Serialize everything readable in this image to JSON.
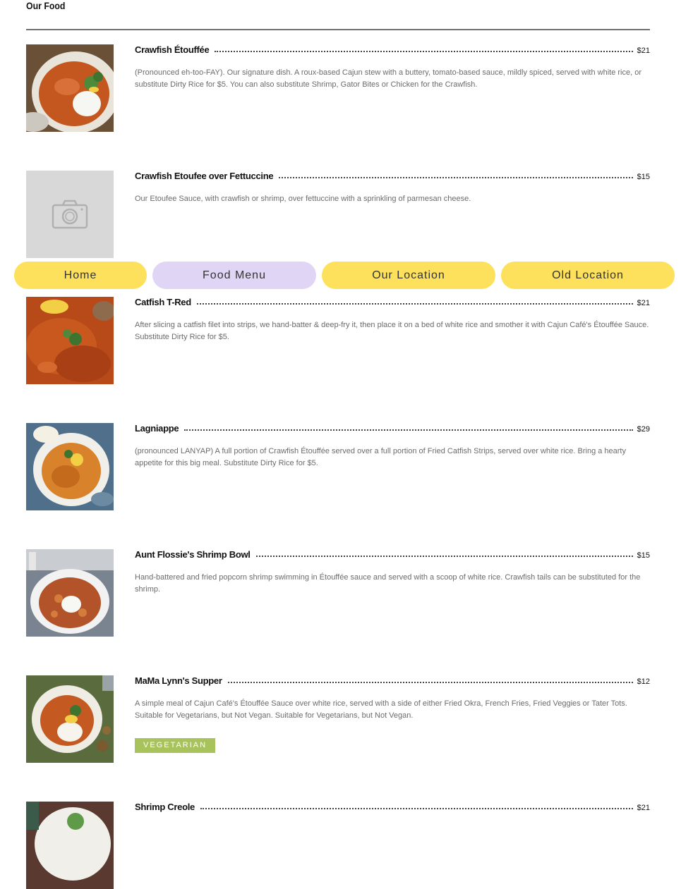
{
  "section": {
    "title": "Our Food"
  },
  "nav": {
    "items": [
      {
        "label": "Home"
      },
      {
        "label": "Food Menu",
        "active": true
      },
      {
        "label": "Our Location"
      },
      {
        "label": "Old Location"
      }
    ],
    "colors": {
      "default": "#fde15c",
      "active": "#e1d5f5"
    }
  },
  "menu": {
    "items": [
      {
        "name": "Crawfish Étouffée",
        "price": "$21",
        "description": "(Pronounced eh-too-FAY). Our signature dish. A roux-based Cajun stew with a buttery, tomato-based sauce, mildly spiced, served with white rice, or substitute Dirty Rice for $5. You can also substitute Shrimp, Gator Bites or Chicken for the Crawfish.",
        "image": "etouffee-photo"
      },
      {
        "name": "Crawfish Etoufee over Fettuccine",
        "price": "$15",
        "description": "Our Etoufee Sauce, with crawfish or shrimp, over fettuccine with a sprinkling of parmesan cheese.",
        "image": "camera-placeholder-icon"
      },
      {
        "name": "Catfish T-Red",
        "price": "$21",
        "description": "After slicing a catfish filet into strips, we hand-batter & deep-fry it, then place it on a bed of white rice and smother it with Cajun Café's Étouffée Sauce. Substitute Dirty Rice for $5.",
        "image": "catfish-photo"
      },
      {
        "name": "Lagniappe",
        "price": "$29",
        "description": "(pronounced LANYAP) A full portion of Crawfish Étouffée served over a full portion of Fried Catfish Strips, served over white rice. Bring a hearty appetite for this big meal. Substitute Dirty Rice for $5.",
        "image": "lagniappe-photo"
      },
      {
        "name": "Aunt Flossie's Shrimp Bowl",
        "price": "$15",
        "description": "Hand-battered and fried popcorn shrimp swimming in Étouffée sauce and served with a scoop of white rice. Crawfish tails can be substituted for the shrimp.",
        "image": "shrimp-bowl-photo"
      },
      {
        "name": "MaMa Lynn's Supper",
        "price": "$12",
        "description": "A simple meal of Cajun Café's Étouffée Sauce over white rice, served with a side of either Fried Okra, French Fries, Fried Veggies or Tater Tots. Suitable for Vegetarians, but Not Vegan. Suitable for Vegetarians, but Not Vegan.",
        "badge": "VEGETARIAN",
        "image": "supper-photo"
      },
      {
        "name": "Shrimp Creole",
        "price": "$21",
        "description": "",
        "image": "creole-photo"
      }
    ]
  },
  "colors": {
    "badge": "#a8c25c",
    "rule": "#707070"
  }
}
